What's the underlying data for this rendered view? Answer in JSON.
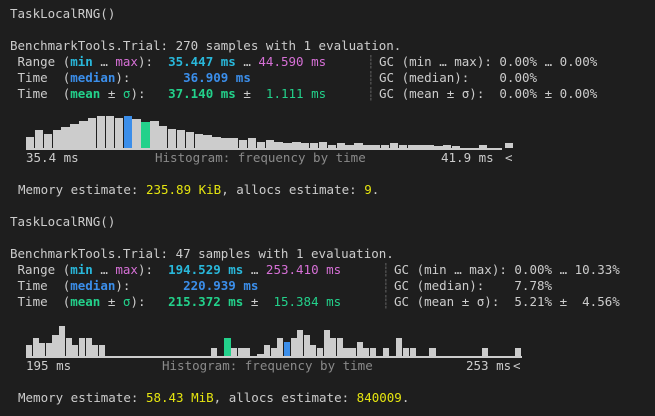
{
  "colors": {
    "background": "#1e1e1e",
    "text": "#cccccc",
    "cyan": "#29b8db",
    "magenta": "#d670d6",
    "blue": "#3b8eea",
    "green": "#23d18b",
    "yellow": "#e5e510",
    "muted": "#8a8a8a"
  },
  "bench1": {
    "header": "TaskLocalRNG()",
    "trial": "BenchmarkTools.Trial: 270 samples with 1 evaluation.",
    "range": {
      "label": " Range ",
      "lp": "(",
      "min": "min",
      "dots": " … ",
      "max": "max",
      "rp": "):",
      "minval": "35.447 ms",
      "mid": " … ",
      "maxval": "44.590 ms"
    },
    "median": {
      "label": " Time  ",
      "lp": "(",
      "key": "median",
      "rp": "):",
      "val": "36.909 ms"
    },
    "mean": {
      "label": " Time  ",
      "lp": "(",
      "key": "mean",
      "pm": " ± ",
      "sigma": "σ",
      "rp": "):",
      "val": "37.140 ms",
      "pm2": " ± ",
      "std": "1.111 ms"
    },
    "gc": {
      "range": "GC (min … max): 0.00% … 0.00%",
      "median": "GC (median):    0.00%",
      "mean": "GC (mean ± σ):  0.00% ± 0.00%"
    },
    "hist_left": "35.4 ms",
    "hist_title": "Histogram: frequency by time",
    "hist_right": "41.9 ms",
    "hist_arrow": "<",
    "memory": {
      "p1": "Memory estimate: ",
      "v1": "235.89 KiB",
      "p2": ", allocs estimate: ",
      "v2": "9",
      "p3": "."
    },
    "bars": [
      0.35,
      0.55,
      0.45,
      0.55,
      0.65,
      0.75,
      0.85,
      0.95,
      1.0,
      1.0,
      0.95,
      1.0,
      0.9,
      0.8,
      0.85,
      0.7,
      0.6,
      0.55,
      0.5,
      0.45,
      0.4,
      0.35,
      0.3,
      0.3,
      0.25,
      0.3,
      0.2,
      0.25,
      0.2,
      0.15,
      0.2,
      0.15,
      0.15,
      0.2,
      0.1,
      0.15,
      0.1,
      0.15,
      0.1,
      0.1,
      0.1,
      0.15,
      0.1,
      0.1,
      0.1,
      0.1,
      0.05,
      0.1,
      0.05,
      0.0,
      0.0,
      0.1,
      0.0,
      0.0,
      0.15
    ],
    "bar_median_index": 11,
    "bar_mean_index": 13
  },
  "bench2": {
    "header": "TaskLocalRNG()",
    "trial": "BenchmarkTools.Trial: 47 samples with 1 evaluation.",
    "range": {
      "label": " Range ",
      "lp": "(",
      "min": "min",
      "dots": " … ",
      "max": "max",
      "rp": "):",
      "minval": "194.529 ms",
      "mid": " … ",
      "maxval": "253.410 ms"
    },
    "median": {
      "label": " Time  ",
      "lp": "(",
      "key": "median",
      "rp": "):",
      "val": "220.939 ms"
    },
    "mean": {
      "label": " Time  ",
      "lp": "(",
      "key": "mean",
      "pm": " ± ",
      "sigma": "σ",
      "rp": "):",
      "val": "215.372 ms",
      "pm2": " ± ",
      "std": "15.384 ms"
    },
    "gc": {
      "range": "GC (min … max): 0.00% … 10.33%",
      "median": "GC (median):    7.78%",
      "mean": "GC (mean ± σ):  5.21% ±  4.56%"
    },
    "hist_left": "195 ms",
    "hist_title": "Histogram: frequency by time",
    "hist_right": "253 ms",
    "hist_arrow": "<",
    "memory": {
      "p1": "Memory estimate: ",
      "v1": "58.43 MiB",
      "p2": ", allocs estimate: ",
      "v2": "840009",
      "p3": "."
    },
    "bars": [
      0.35,
      0.55,
      0.4,
      0.4,
      0.65,
      0.95,
      0.55,
      0.35,
      0.55,
      0.55,
      0.35,
      0.35,
      0.0,
      0.0,
      0.0,
      0.0,
      0.0,
      0.0,
      0.0,
      0.0,
      0.0,
      0.0,
      0.0,
      0.0,
      0.0,
      0.0,
      0.0,
      0.0,
      0.25,
      0.0,
      0.55,
      0.25,
      0.25,
      0.25,
      0.0,
      0.05,
      0.35,
      0.25,
      0.55,
      0.45,
      0.55,
      0.8,
      0.65,
      0.35,
      0.25,
      0.8,
      0.55,
      0.55,
      0.25,
      0.25,
      0.45,
      0.25,
      0.25,
      0.0,
      0.25,
      0.0,
      0.55,
      0.25,
      0.25,
      0.0,
      0.0,
      0.25,
      0.0,
      0.0,
      0.0,
      0.0,
      0.0,
      0.0,
      0.0,
      0.25,
      0.0,
      0.0,
      0.0,
      0.0,
      0.25
    ],
    "bar_median_index": 39,
    "bar_mean_index": 30
  }
}
